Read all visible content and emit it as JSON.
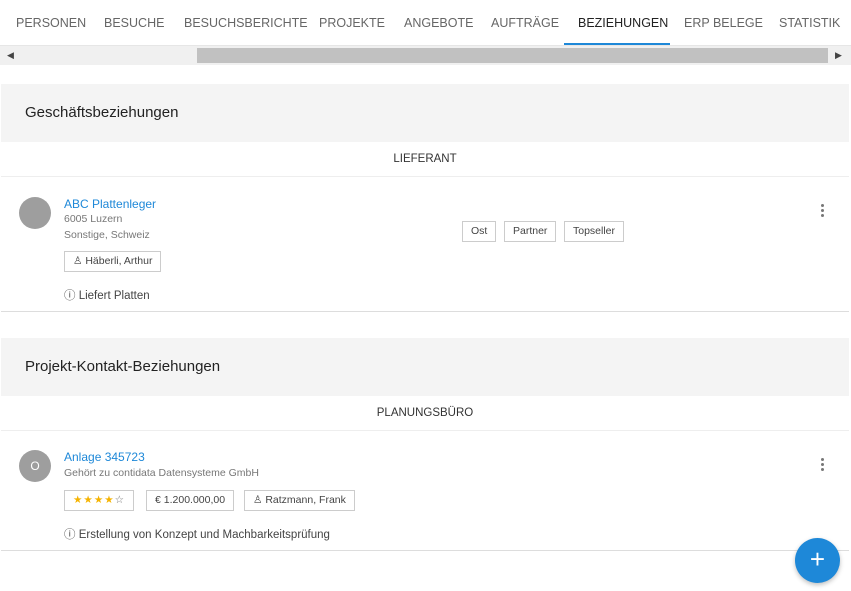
{
  "tabs": [
    {
      "label": "PERSONEN"
    },
    {
      "label": "BESUCHE"
    },
    {
      "label": "BESUCHSBERICHTE"
    },
    {
      "label": "PROJEKTE"
    },
    {
      "label": "ANGEBOTE"
    },
    {
      "label": "AUFTRÄGE"
    },
    {
      "label": "BEZIEHUNGEN"
    },
    {
      "label": "ERP BELEGE"
    },
    {
      "label": "STATISTIK"
    }
  ],
  "active_tab": "BEZIEHUNGEN",
  "sections": [
    {
      "title": "Geschäftsbeziehungen",
      "group": "LIEFERANT",
      "card": {
        "name": "ABC Plattenleger",
        "address_line1": "6005 Luzern",
        "address_line2": "Sonstige, Schweiz",
        "contact": "Häberli, Arthur",
        "tags": [
          "Ost",
          "Partner",
          "Topseller"
        ],
        "note": "Liefert Platten"
      }
    },
    {
      "title": "Projekt-Kontakt-Beziehungen",
      "group": "PLANUNGSBÜRO",
      "card": {
        "avatar_letter": "O",
        "name": "Anlage 345723",
        "subtitle": "Gehört zu contidata Datensysteme GmbH",
        "rating": 4,
        "rating_max": 5,
        "amount": "€ 1.200.000,00",
        "contact": "Ratzmann, Frank",
        "note": "Erstellung von Konzept und Machbarkeitsprüfung"
      }
    }
  ],
  "fab_label": "+",
  "icons": {
    "scroll_left": "scroll-left-arrow-icon",
    "scroll_right": "scroll-right-arrow-icon",
    "person": "person-icon",
    "info": "info-icon",
    "more": "more-vertical-icon",
    "add": "add-icon"
  },
  "colors": {
    "accent": "#1e88d8",
    "star": "#f5b300"
  }
}
